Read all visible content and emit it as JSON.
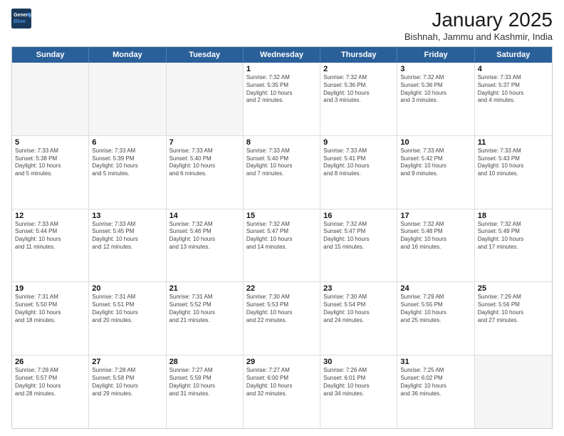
{
  "header": {
    "logo_line1": "General",
    "logo_line2": "Blue",
    "month_title": "January 2025",
    "location": "Bishnah, Jammu and Kashmir, India"
  },
  "weekdays": [
    "Sunday",
    "Monday",
    "Tuesday",
    "Wednesday",
    "Thursday",
    "Friday",
    "Saturday"
  ],
  "rows": [
    [
      {
        "day": "",
        "empty": true
      },
      {
        "day": "",
        "empty": true
      },
      {
        "day": "",
        "empty": true
      },
      {
        "day": "1",
        "lines": [
          "Sunrise: 7:32 AM",
          "Sunset: 5:35 PM",
          "Daylight: 10 hours",
          "and 2 minutes."
        ]
      },
      {
        "day": "2",
        "lines": [
          "Sunrise: 7:32 AM",
          "Sunset: 5:36 PM",
          "Daylight: 10 hours",
          "and 3 minutes."
        ]
      },
      {
        "day": "3",
        "lines": [
          "Sunrise: 7:32 AM",
          "Sunset: 5:36 PM",
          "Daylight: 10 hours",
          "and 3 minutes."
        ]
      },
      {
        "day": "4",
        "lines": [
          "Sunrise: 7:33 AM",
          "Sunset: 5:37 PM",
          "Daylight: 10 hours",
          "and 4 minutes."
        ]
      }
    ],
    [
      {
        "day": "5",
        "lines": [
          "Sunrise: 7:33 AM",
          "Sunset: 5:38 PM",
          "Daylight: 10 hours",
          "and 5 minutes."
        ]
      },
      {
        "day": "6",
        "lines": [
          "Sunrise: 7:33 AM",
          "Sunset: 5:39 PM",
          "Daylight: 10 hours",
          "and 5 minutes."
        ]
      },
      {
        "day": "7",
        "lines": [
          "Sunrise: 7:33 AM",
          "Sunset: 5:40 PM",
          "Daylight: 10 hours",
          "and 6 minutes."
        ]
      },
      {
        "day": "8",
        "lines": [
          "Sunrise: 7:33 AM",
          "Sunset: 5:40 PM",
          "Daylight: 10 hours",
          "and 7 minutes."
        ]
      },
      {
        "day": "9",
        "lines": [
          "Sunrise: 7:33 AM",
          "Sunset: 5:41 PM",
          "Daylight: 10 hours",
          "and 8 minutes."
        ]
      },
      {
        "day": "10",
        "lines": [
          "Sunrise: 7:33 AM",
          "Sunset: 5:42 PM",
          "Daylight: 10 hours",
          "and 9 minutes."
        ]
      },
      {
        "day": "11",
        "lines": [
          "Sunrise: 7:33 AM",
          "Sunset: 5:43 PM",
          "Daylight: 10 hours",
          "and 10 minutes."
        ]
      }
    ],
    [
      {
        "day": "12",
        "lines": [
          "Sunrise: 7:33 AM",
          "Sunset: 5:44 PM",
          "Daylight: 10 hours",
          "and 11 minutes."
        ]
      },
      {
        "day": "13",
        "lines": [
          "Sunrise: 7:33 AM",
          "Sunset: 5:45 PM",
          "Daylight: 10 hours",
          "and 12 minutes."
        ]
      },
      {
        "day": "14",
        "lines": [
          "Sunrise: 7:32 AM",
          "Sunset: 5:46 PM",
          "Daylight: 10 hours",
          "and 13 minutes."
        ]
      },
      {
        "day": "15",
        "lines": [
          "Sunrise: 7:32 AM",
          "Sunset: 5:47 PM",
          "Daylight: 10 hours",
          "and 14 minutes."
        ]
      },
      {
        "day": "16",
        "lines": [
          "Sunrise: 7:32 AM",
          "Sunset: 5:47 PM",
          "Daylight: 10 hours",
          "and 15 minutes."
        ]
      },
      {
        "day": "17",
        "lines": [
          "Sunrise: 7:32 AM",
          "Sunset: 5:48 PM",
          "Daylight: 10 hours",
          "and 16 minutes."
        ]
      },
      {
        "day": "18",
        "lines": [
          "Sunrise: 7:32 AM",
          "Sunset: 5:49 PM",
          "Daylight: 10 hours",
          "and 17 minutes."
        ]
      }
    ],
    [
      {
        "day": "19",
        "lines": [
          "Sunrise: 7:31 AM",
          "Sunset: 5:50 PM",
          "Daylight: 10 hours",
          "and 18 minutes."
        ]
      },
      {
        "day": "20",
        "lines": [
          "Sunrise: 7:31 AM",
          "Sunset: 5:51 PM",
          "Daylight: 10 hours",
          "and 20 minutes."
        ]
      },
      {
        "day": "21",
        "lines": [
          "Sunrise: 7:31 AM",
          "Sunset: 5:52 PM",
          "Daylight: 10 hours",
          "and 21 minutes."
        ]
      },
      {
        "day": "22",
        "lines": [
          "Sunrise: 7:30 AM",
          "Sunset: 5:53 PM",
          "Daylight: 10 hours",
          "and 22 minutes."
        ]
      },
      {
        "day": "23",
        "lines": [
          "Sunrise: 7:30 AM",
          "Sunset: 5:54 PM",
          "Daylight: 10 hours",
          "and 24 minutes."
        ]
      },
      {
        "day": "24",
        "lines": [
          "Sunrise: 7:29 AM",
          "Sunset: 5:55 PM",
          "Daylight: 10 hours",
          "and 25 minutes."
        ]
      },
      {
        "day": "25",
        "lines": [
          "Sunrise: 7:29 AM",
          "Sunset: 5:56 PM",
          "Daylight: 10 hours",
          "and 27 minutes."
        ]
      }
    ],
    [
      {
        "day": "26",
        "lines": [
          "Sunrise: 7:28 AM",
          "Sunset: 5:57 PM",
          "Daylight: 10 hours",
          "and 28 minutes."
        ]
      },
      {
        "day": "27",
        "lines": [
          "Sunrise: 7:28 AM",
          "Sunset: 5:58 PM",
          "Daylight: 10 hours",
          "and 29 minutes."
        ]
      },
      {
        "day": "28",
        "lines": [
          "Sunrise: 7:27 AM",
          "Sunset: 5:59 PM",
          "Daylight: 10 hours",
          "and 31 minutes."
        ]
      },
      {
        "day": "29",
        "lines": [
          "Sunrise: 7:27 AM",
          "Sunset: 6:00 PM",
          "Daylight: 10 hours",
          "and 32 minutes."
        ]
      },
      {
        "day": "30",
        "lines": [
          "Sunrise: 7:26 AM",
          "Sunset: 6:01 PM",
          "Daylight: 10 hours",
          "and 34 minutes."
        ]
      },
      {
        "day": "31",
        "lines": [
          "Sunrise: 7:25 AM",
          "Sunset: 6:02 PM",
          "Daylight: 10 hours",
          "and 36 minutes."
        ]
      },
      {
        "day": "",
        "empty": true
      }
    ]
  ]
}
